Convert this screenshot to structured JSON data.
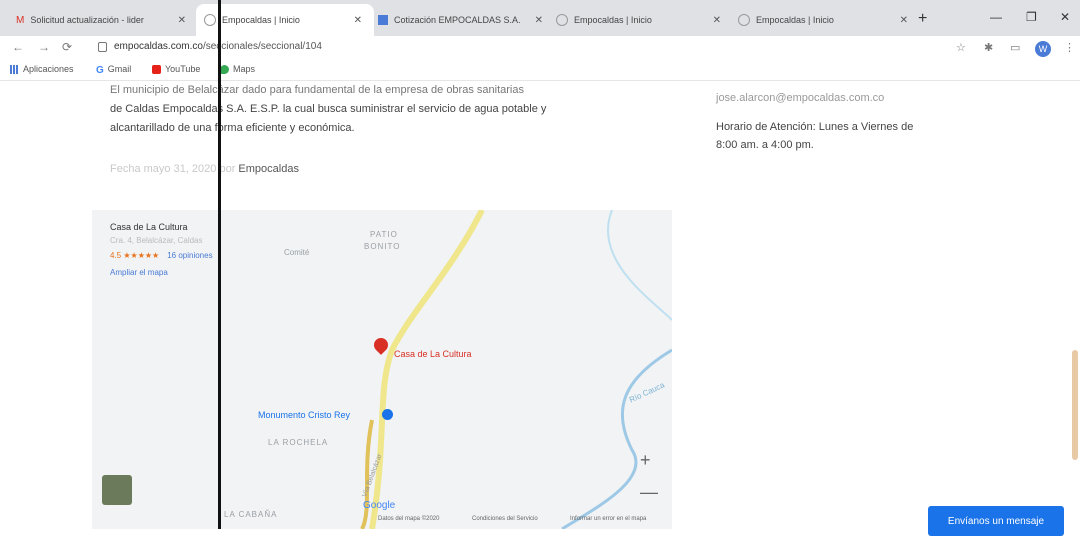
{
  "tabs": [
    {
      "label": "Solicitud actualización - lider",
      "icon": "gmail-icon"
    },
    {
      "label": "Empocaldas | Inicio",
      "icon": "globe-icon"
    },
    {
      "label": "Cotización EMPOCALDAS S.A.",
      "icon": "doc-icon"
    },
    {
      "label": "Empocaldas | Inicio",
      "icon": "globe-icon"
    },
    {
      "label": "Empocaldas | Inicio",
      "icon": "globe-icon"
    }
  ],
  "toolbar": {
    "url_host": "empocaldas.com.co",
    "url_path": "/seccionales/seccional/104",
    "avatar_letter": "W"
  },
  "bookmarks": [
    {
      "label": "Aplicaciones",
      "icon": "apps-icon"
    },
    {
      "label": "Gmail",
      "icon": "google-icon"
    },
    {
      "label": "YouTube",
      "icon": "youtube-icon"
    },
    {
      "label": "Maps",
      "icon": "maps-icon"
    }
  ],
  "article": {
    "paragraph_line1": "El municipio de Belalcázar dado para fundamental de la empresa de obras sanitarias",
    "paragraph_line2": "de Caldas Empocaldas S.A. E.S.P. la cual busca suministrar el servicio de agua potable y",
    "paragraph_line3": "alcantarillado de una forma eficiente y económica.",
    "date_prefix": "Fecha mayo 31, 2020 por",
    "author": "Empocaldas"
  },
  "contact": {
    "email": "jose.alarcon@empocaldas.com.co",
    "hours_line1": "Horario de Atención: Lunes a Viernes de",
    "hours_line2": "8:00 am. a 4:00 pm."
  },
  "map": {
    "place_name": "Casa de La Cultura",
    "place_address": "Cra. 4, Belalcázar, Caldas",
    "rating": "4.5 ★★★★★",
    "reviews": "16 opiniones",
    "enlarge": "Ampliar el mapa",
    "labels": {
      "patio": "PATIO",
      "bonito": "BONITO",
      "la_rochela": "LA ROCHELA",
      "la_cabana": "LA CABAÑA",
      "comite": "Comité",
      "rio": "Río Cauca",
      "via": "Vía Belalcázar"
    },
    "pin_label": "Casa de La Cultura",
    "poi_label": "Monumento Cristo Rey",
    "zoom_in": "+",
    "zoom_out": "—",
    "google": "Google",
    "footer_data": "Datos del mapa ©2020",
    "footer_terms": "Condiciones del Servicio",
    "footer_report": "Informar un error en el mapa"
  },
  "cta_label": "Envíanos un mensaje",
  "colors": {
    "accent": "#1a73e8",
    "pin": "#d93025",
    "road": "#f0e68c"
  }
}
